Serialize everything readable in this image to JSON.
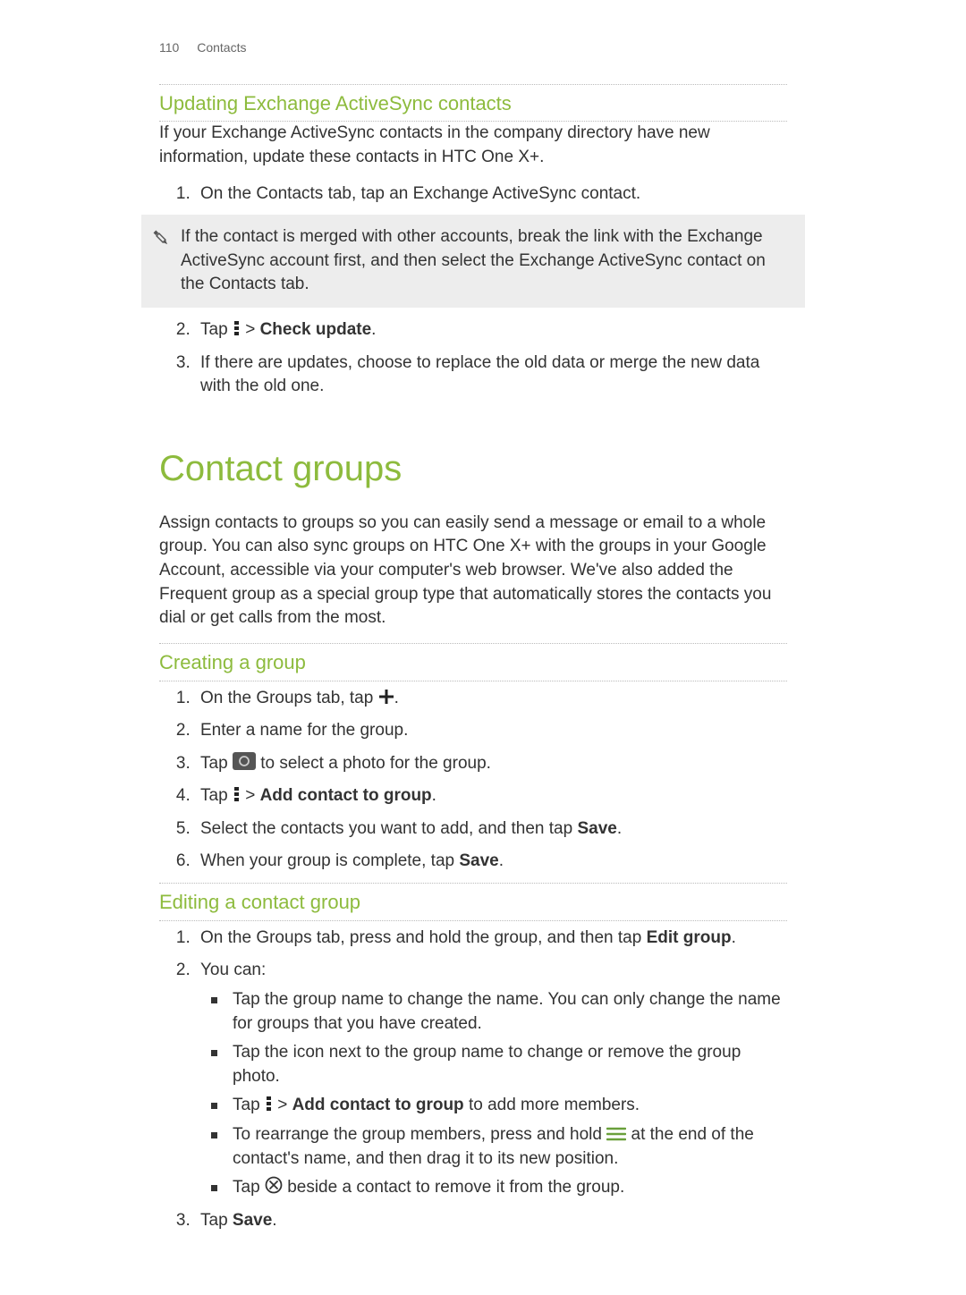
{
  "header": {
    "page_number": "110",
    "section": "Contacts"
  },
  "sectionA": {
    "title": "Updating Exchange ActiveSync contacts",
    "intro": "If your Exchange ActiveSync contacts in the company directory have new information, update these contacts in HTC One X+.",
    "step1": "On the Contacts tab, tap an Exchange ActiveSync contact.",
    "tip": "If the contact is merged with other accounts, break the link with the Exchange ActiveSync account first, and then select the Exchange ActiveSync contact on the Contacts tab.",
    "step2_pre": "Tap ",
    "step2_sep": " > ",
    "step2_bold": "Check update",
    "step2_post": ".",
    "step3": "If there are updates, choose to replace the old data or merge the new data with the old one."
  },
  "sectionB": {
    "title": "Contact groups",
    "intro": "Assign contacts to groups so you can easily send a message or email to a whole group. You can also sync groups on HTC One X+ with the groups in your Google Account, accessible via your computer's web browser. We've also added the Frequent group as a special group type that automatically stores the contacts you dial or get calls from the most."
  },
  "sectionC": {
    "title": "Creating a group",
    "step1_pre": "On the Groups tab, tap ",
    "step1_post": ".",
    "step2": "Enter a name for the group.",
    "step3_pre": "Tap ",
    "step3_post": " to select a photo for the group.",
    "step4_pre": "Tap ",
    "step4_sep": " > ",
    "step4_bold": "Add contact to group",
    "step4_post": ".",
    "step5_pre": "Select the contacts you want to add, and then tap ",
    "step5_bold": "Save",
    "step5_post": ".",
    "step6_pre": "When your group is complete, tap ",
    "step6_bold": "Save",
    "step6_post": "."
  },
  "sectionD": {
    "title": "Editing a contact group",
    "step1_pre": "On the Groups tab, press and hold the group, and then tap ",
    "step1_bold": "Edit group",
    "step1_post": ".",
    "step2_intro": "You can:",
    "b1": "Tap the group name to change the name. You can only change the name for groups that you have created.",
    "b2": "Tap the icon next to the group name to change or remove the group photo.",
    "b3_pre": "Tap ",
    "b3_sep": " > ",
    "b3_bold": "Add contact to group",
    "b3_post": " to add more members.",
    "b4_pre": "To rearrange the group members, press and hold ",
    "b4_post": " at the end of the contact's name, and then drag it to its new position.",
    "b5_pre": "Tap ",
    "b5_post": " beside a contact to remove it from the group.",
    "step3_pre": "Tap ",
    "step3_bold": "Save",
    "step3_post": "."
  }
}
